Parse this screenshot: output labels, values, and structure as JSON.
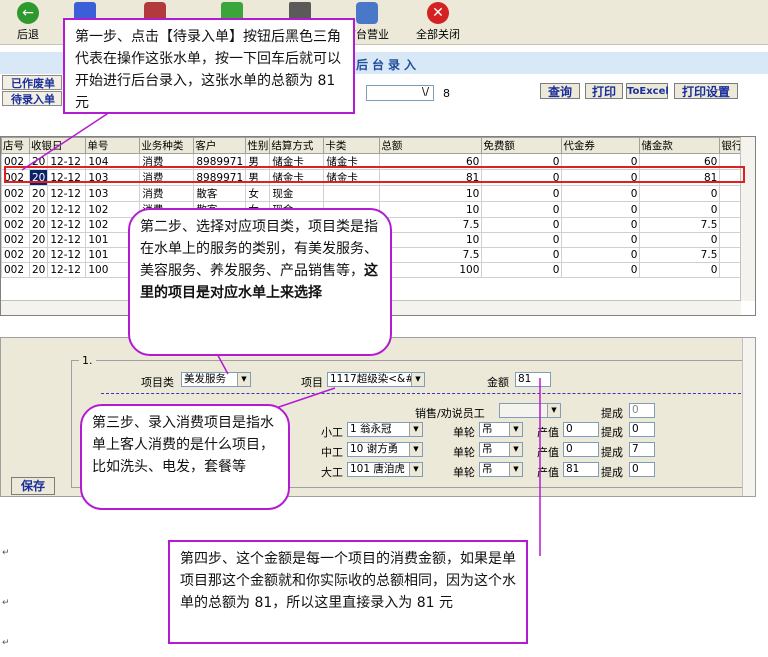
{
  "toolbar": {
    "buttons": [
      {
        "label": "后退",
        "icon": "back-icon",
        "color": "#2e9a2e"
      },
      {
        "label": "",
        "icon": "stack-icon",
        "color": "#3a5fd6"
      },
      {
        "label": "",
        "icon": "people-icon",
        "color": "#b23a3a"
      },
      {
        "label": "",
        "icon": "network-icon",
        "color": "#3aa53a"
      },
      {
        "label": "",
        "icon": "calculator-icon",
        "color": "#5a5a5a"
      },
      {
        "label": "前台营业",
        "icon": "store-icon",
        "color": "#4a78c8"
      },
      {
        "label": "全部关闭",
        "icon": "close-all-icon",
        "color": "#d42222"
      }
    ]
  },
  "titlebar": {
    "title": "展后台录入"
  },
  "side_buttons": {
    "done": "已作废单",
    "pending": "待录入单"
  },
  "search": {
    "value": "\\/",
    "count": "8"
  },
  "actions": {
    "query": "查询",
    "print": "打印",
    "to_excel": "ToExcel",
    "print_settings": "打印设置"
  },
  "table": {
    "headers": [
      "店号",
      "收银日",
      "单号",
      "业务种类",
      "客户",
      "性别",
      "结算方式",
      "卡类",
      "总额",
      "免费额",
      "代金券",
      "储金款",
      "银行"
    ],
    "rows": [
      [
        "002",
        "20",
        "12-12",
        "104",
        "消费",
        "8989971",
        "男",
        "储金卡",
        "储金卡",
        "60",
        "0",
        "0",
        "60"
      ],
      [
        "002",
        "20",
        "12-12",
        "103",
        "消费",
        "8989971",
        "男",
        "储金卡",
        "储金卡",
        "81",
        "0",
        "0",
        "81"
      ],
      [
        "002",
        "20",
        "12-12",
        "103",
        "消费",
        "散客",
        "女",
        "现金",
        "",
        "10",
        "0",
        "0",
        "0"
      ],
      [
        "002",
        "20",
        "12-12",
        "102",
        "消费",
        "散客",
        "女",
        "现金",
        "",
        "10",
        "0",
        "0",
        "0"
      ],
      [
        "002",
        "20",
        "12-12",
        "102",
        "",
        "",
        "",
        "",
        "",
        "7.5",
        "0",
        "0",
        "7.5"
      ],
      [
        "002",
        "20",
        "12-12",
        "101",
        "",
        "",
        "",
        "",
        "",
        "10",
        "0",
        "0",
        "0"
      ],
      [
        "002",
        "20",
        "12-12",
        "101",
        "",
        "",
        "",
        "",
        "",
        "7.5",
        "0",
        "0",
        "7.5"
      ],
      [
        "002",
        "20",
        "12-12",
        "100",
        "",
        "",
        "",
        "",
        "",
        "100",
        "0",
        "0",
        "0"
      ]
    ]
  },
  "form": {
    "group_label": "1.",
    "category_label": "项目类",
    "category_value": "美发服务",
    "item_label": "项目",
    "item_value": "1117超级染<&#",
    "amount_label": "金额",
    "amount_value": "81",
    "sales_staff_label": "销售/劝说员工",
    "commission_label": "提成",
    "commission_value": "0",
    "save_label": "保存",
    "workers": [
      {
        "role": "小工",
        "id_name": "1     翁永冠",
        "wheel_label": "单轮",
        "wheel_value": "吊",
        "output_label": "产值",
        "output_value": "0",
        "commission_label": "提成",
        "commission_value": "0"
      },
      {
        "role": "中工",
        "id_name": "10  谢方勇",
        "wheel_label": "单轮",
        "wheel_value": "吊",
        "output_label": "产值",
        "output_value": "0",
        "commission_label": "提成",
        "commission_value": "7"
      },
      {
        "role": "大工",
        "id_name": "101 唐洎虎",
        "wheel_label": "单轮",
        "wheel_value": "吊",
        "output_label": "产值",
        "output_value": "81",
        "commission_label": "提成",
        "commission_value": "0"
      }
    ]
  },
  "callouts": {
    "step1": "第一步、点击【待录入单】按钮后黑色三角代表在操作这张水单，按一下回车后就可以开始进行后台录入，这张水单的总额为 81 元",
    "step2a": "第二步、选择对应项目类，项目类是指在水单上的服务的类别，有美发服务、美容服务、养发服务、产品销售等，",
    "step2b": "这里的项目是对应水单上来选择",
    "step3": "第三步、录入消费项目是指水单上客人消费的是什么项目，比如洗头、电发，套餐等",
    "step4": "第四步、这个金额是每一个项目的消费金额，如果是单项目那这个金额就和你实际收的总额相同，因为这个水单的总额为 81，所以这里直接录入为 81 元"
  },
  "colors": {
    "callout_border": "#b31bd2",
    "highlight_border": "#e02020",
    "selected_cell": "#0a246a",
    "accent_blue": "#1a2f9c"
  }
}
